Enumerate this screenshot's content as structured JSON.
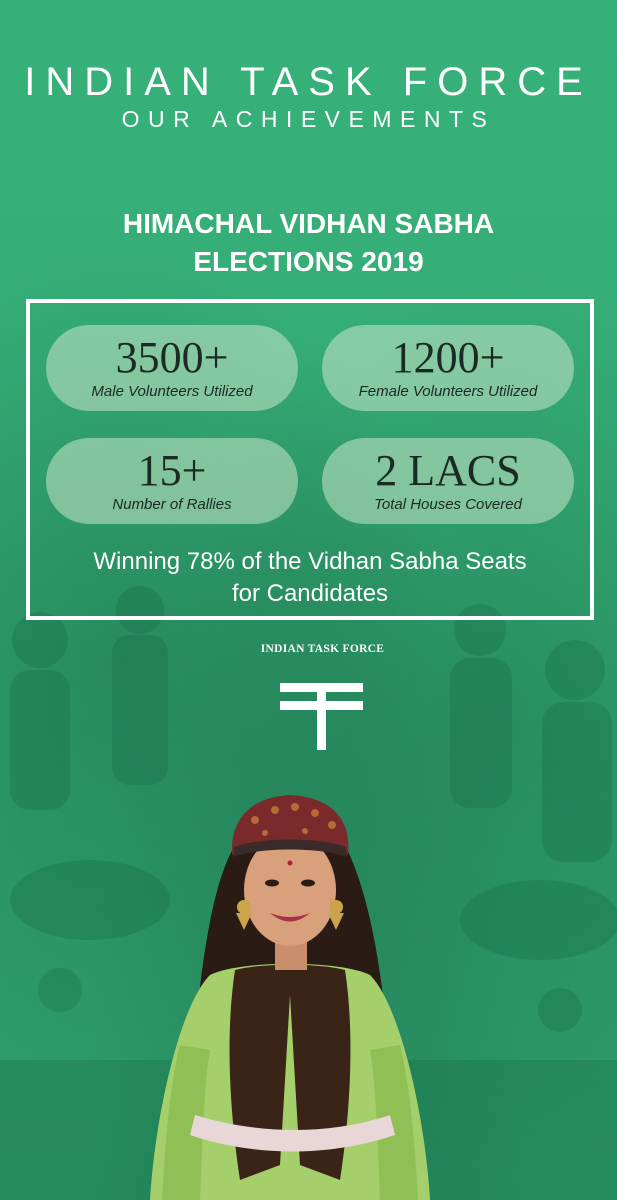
{
  "header": {
    "title": "INDIAN TASK FORCE",
    "subtitle": "OUR ACHIEVEMENTS"
  },
  "section": {
    "title_line1": "HIMACHAL VIDHAN SABHA",
    "title_line2": "ELECTIONS 2019"
  },
  "stats": [
    {
      "value": "3500+",
      "label": "Male Volunteers Utilized"
    },
    {
      "value": "1200+",
      "label": "Female Volunteers Utilized"
    },
    {
      "value": "15+",
      "label": "Number of Rallies"
    },
    {
      "value": "2 LACS",
      "label": "Total Houses Covered"
    }
  ],
  "result": {
    "line1": "Winning 78% of the Vidhan Sabha Seats",
    "line2": "for Candidates"
  },
  "logo": {
    "text": "INDIAN TASK FORCE"
  },
  "colors": {
    "background": "#35ad77",
    "pill": "#c8e6c8",
    "text_light": "#ffffff",
    "text_dark": "#1b2a22"
  }
}
